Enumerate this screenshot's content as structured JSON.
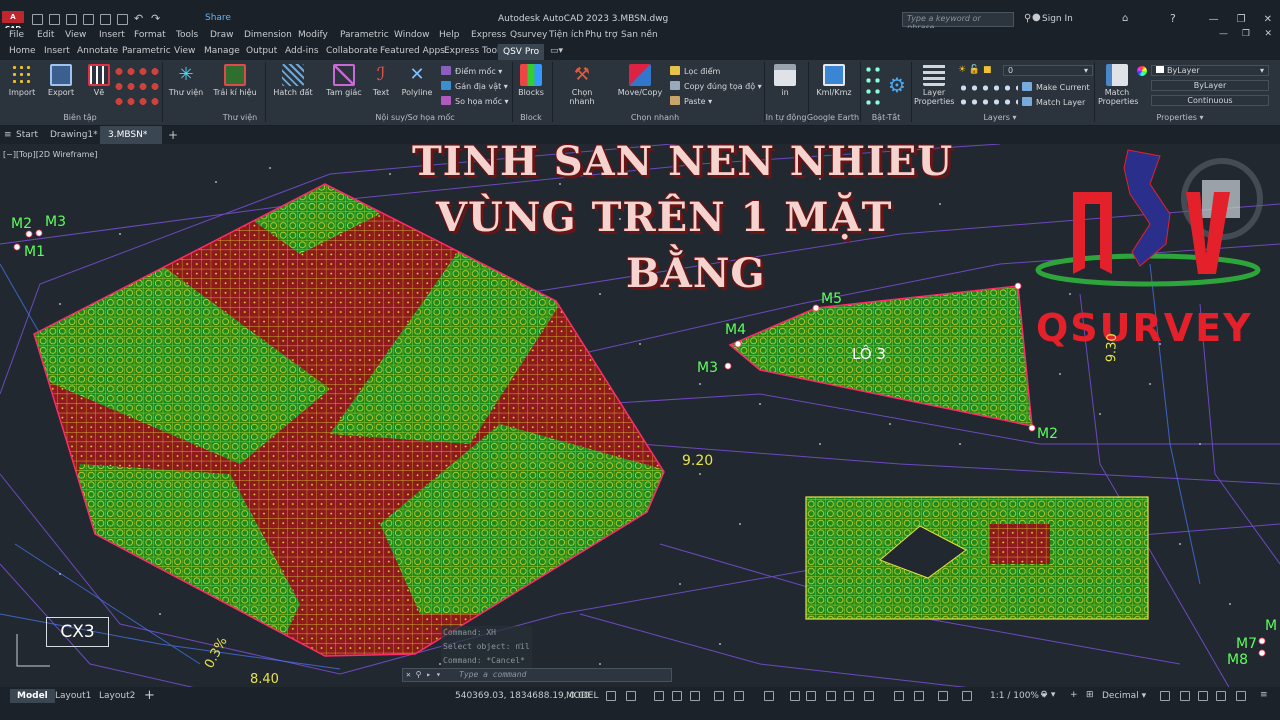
{
  "app": {
    "logo": "A CAD",
    "title": "Autodesk AutoCAD 2023    3.MBSN.dwg",
    "share": "Share",
    "search_placeholder": "Type a keyword or phrase",
    "signin": "Sign In"
  },
  "menu": [
    "File",
    "Edit",
    "View",
    "Insert",
    "Format",
    "Tools",
    "Draw",
    "Dimension",
    "Modify",
    "Parametric",
    "Window",
    "Help",
    "Express",
    "Qsurvey",
    "Tiện ích",
    "Phụ trợ",
    "San nền"
  ],
  "ribbon_tabs": [
    "Home",
    "Insert",
    "Annotate",
    "Parametric",
    "View",
    "Manage",
    "Output",
    "Add-ins",
    "Collaborate",
    "Featured Apps",
    "Express Tools",
    "QSV Pro"
  ],
  "ribbon": {
    "import": "Import",
    "export": "Export",
    "ve": "Vẽ",
    "panel_bientap": "Biên tập",
    "thuvien_btn": "Thư viện",
    "traikihieu": "Trải kí hiệu",
    "panel_thuvien": "Thư viện",
    "hatchdat": "Hatch đất",
    "tamgiac": "Tam giác",
    "text": "Text",
    "polyline": "Polyline",
    "diemmoc": "Điểm mốc",
    "gandiavat": "Gán địa vật",
    "sohoamoc": "So họa mốc",
    "panel_noisuy": "Nội suy/Sơ họa mốc",
    "blocks": "Blocks",
    "panel_block": "Block",
    "chonnhanh": "Chọn nhanh",
    "movecopy": "Move/Copy",
    "locdiem": "Lọc điểm",
    "copydungtoado": "Copy đúng tọa độ",
    "paste": "Paste",
    "panel_chonnhanh": "Chọn nhanh",
    "in": "in",
    "panel_intudong": "In tự động",
    "kmlkmz": "Kml/Kmz",
    "panel_googleearth": "Google Earth",
    "panel_battat": "Bật-Tắt",
    "layerprops": "Layer Properties",
    "layer_current": "0",
    "makecurrent": "Make Current",
    "matchlayer": "Match Layer",
    "panel_layers": "Layers",
    "matchprops": "Match Properties",
    "color_value": "ByLayer",
    "lineweight_value": "ByLayer",
    "linetype_value": "Continuous",
    "panel_properties": "Properties"
  },
  "doc_tabs": [
    "Start",
    "Drawing1*",
    "3.MBSN*"
  ],
  "viewport_label": "[−][Top][2D Wireframe]",
  "overlay": {
    "headline_line1": "TÍNH SAN NỀN NHIỀU",
    "headline_line2": "VÙNG TRÊN 1 MẶT",
    "headline_line3": "BẰNG",
    "brand": "QSURVEY",
    "lot_label": "LÔ 3",
    "cx3_label": "CX3",
    "contour_920": "9.20",
    "contour_930": "9.30",
    "contour_840": "8.40",
    "slope_label": "0.3%"
  },
  "markers": {
    "m1": "M1",
    "m2a": "M2",
    "m3a": "M3",
    "m3b": "M3",
    "m4": "M4",
    "m5": "M5",
    "m2b": "M2",
    "m7": "M7",
    "m8": "M8",
    "m_top": "M"
  },
  "command": {
    "history": [
      "Command: XH",
      "Select object: nil",
      "Command: *Cancel*"
    ],
    "placeholder": "Type a command"
  },
  "status": {
    "layouts": [
      "Model",
      "Layout1",
      "Layout2"
    ],
    "coords": "540369.03, 1834688.19, 0.00",
    "space": "MODEL",
    "scale": "1:1 / 100%",
    "units": "Decimal"
  },
  "colors": {
    "grid_red": "#8e1b1b",
    "grid_green": "#1a8a1a",
    "grid_lines": "#e8e23a",
    "boundary": "#ff2a6a",
    "accent_red": "#e4212a"
  }
}
